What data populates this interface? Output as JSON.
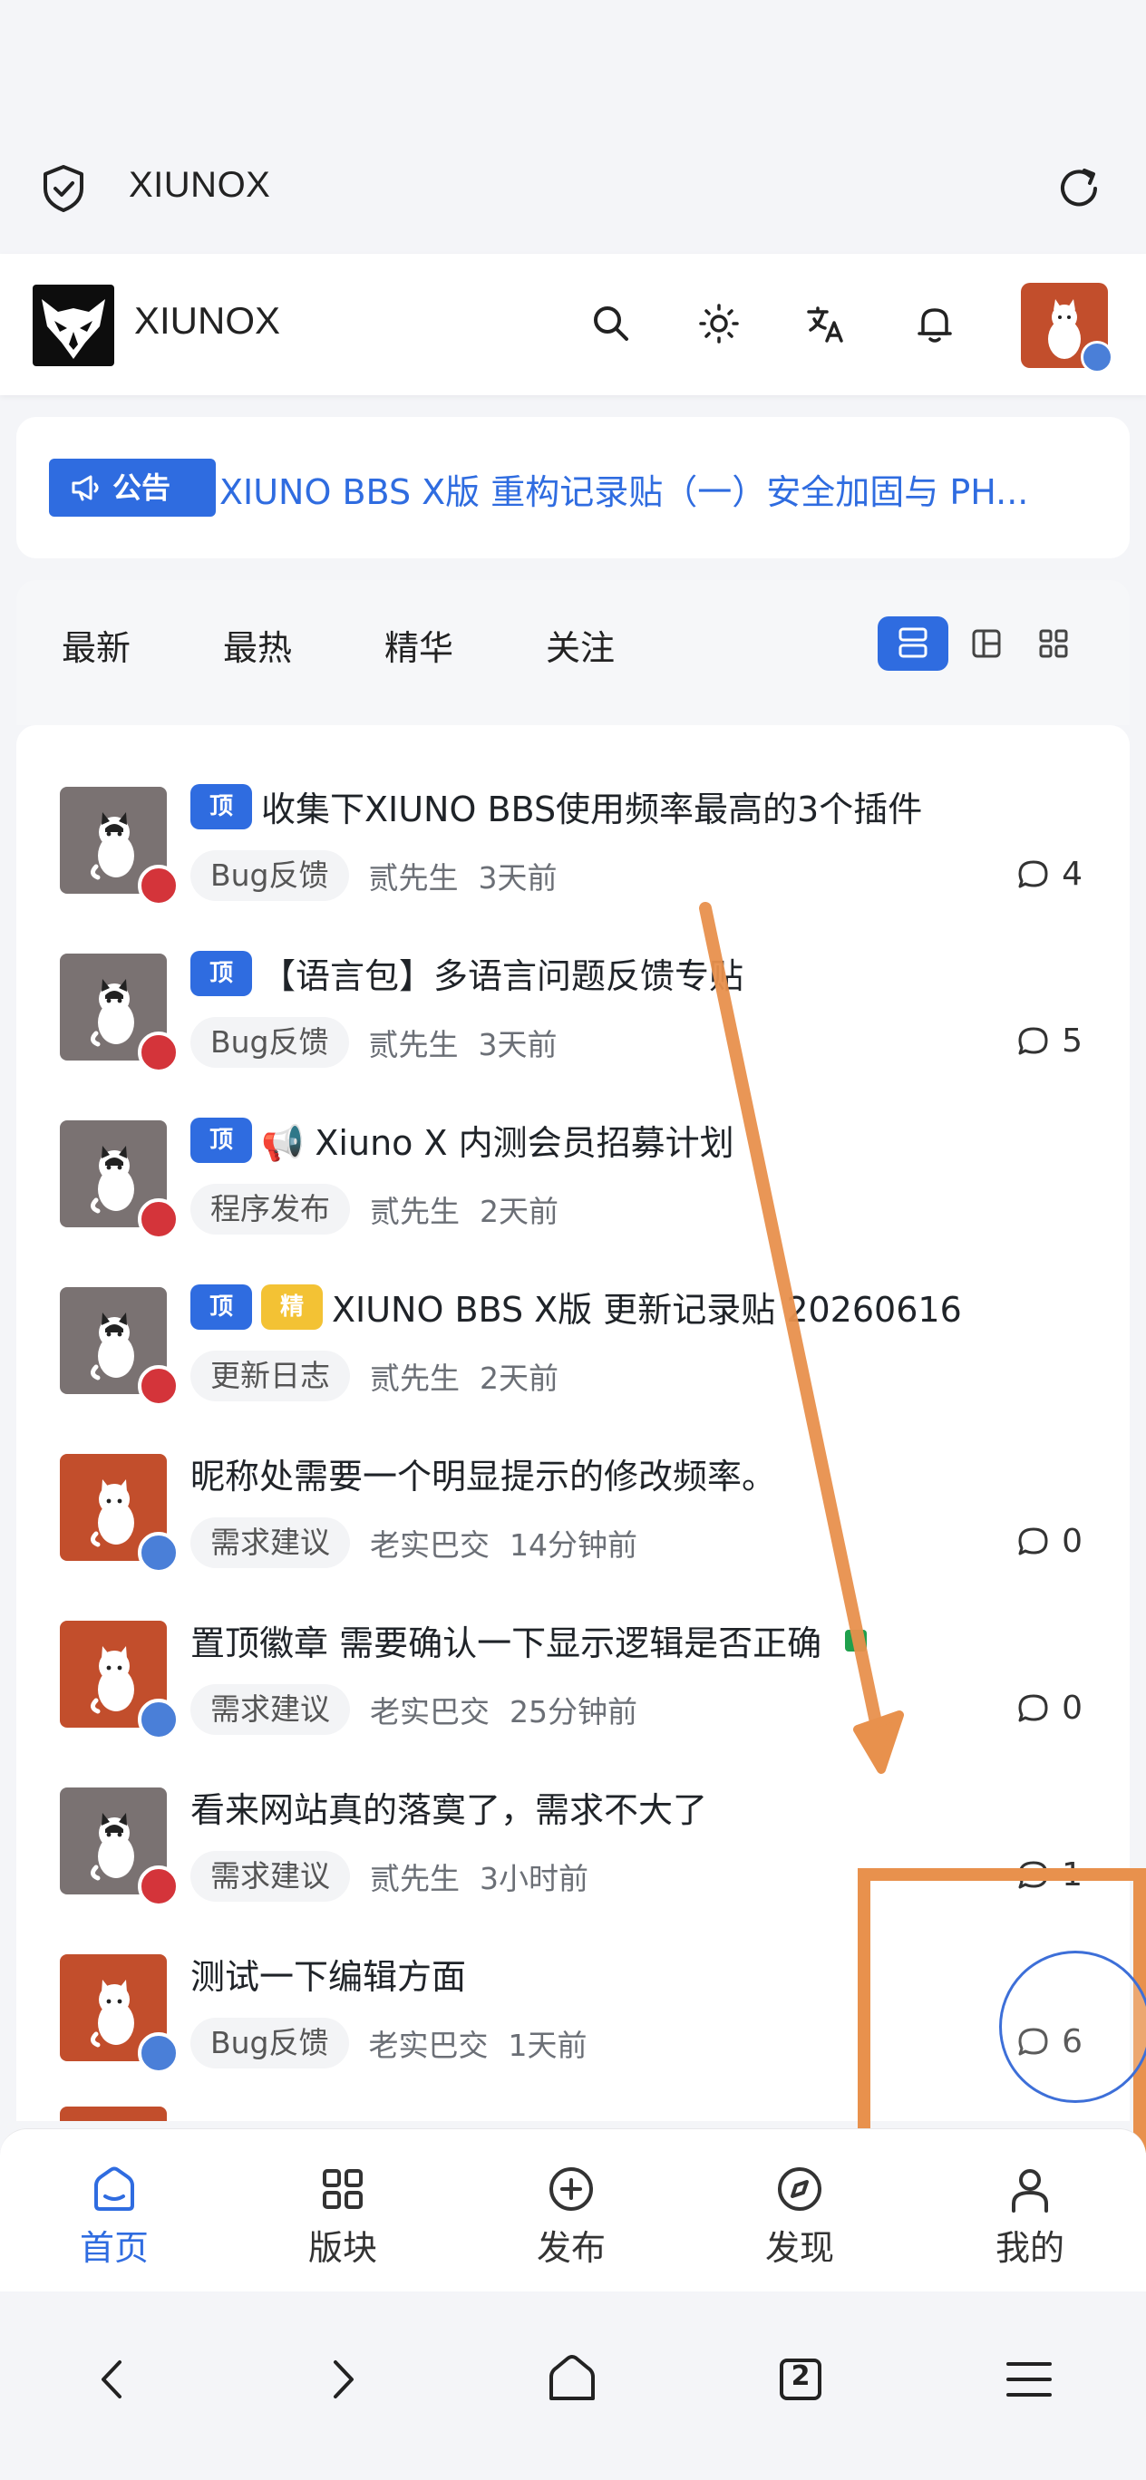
{
  "browser": {
    "url": "XIUNOX"
  },
  "header": {
    "site_name": "XIUNOX"
  },
  "announcement": {
    "badge": "公告",
    "text": "XIUNO BBS X版 重构记录贴（一）安全加固与 PH..."
  },
  "tabs": [
    "最新",
    "最热",
    "精华",
    "关注"
  ],
  "badges": {
    "pin": "顶",
    "featured": "精"
  },
  "topics": [
    {
      "title": "收集下XIUNO BBS使用频率最高的3个插件",
      "pinned": true,
      "featured": false,
      "category": "Bug反馈",
      "author": "贰先生",
      "time": "3天前",
      "replies": "4",
      "avatar": "gray"
    },
    {
      "title": "【语言包】多语言问题反馈专贴",
      "pinned": true,
      "featured": false,
      "category": "Bug反馈",
      "author": "贰先生",
      "time": "3天前",
      "replies": "5",
      "avatar": "gray"
    },
    {
      "title": "📢 Xiuno X 内测会员招募计划",
      "pinned": true,
      "featured": false,
      "category": "程序发布",
      "author": "贰先生",
      "time": "2天前",
      "replies": "",
      "avatar": "gray"
    },
    {
      "title": "XIUNO BBS X版 更新记录贴 20260616",
      "pinned": true,
      "featured": true,
      "category": "更新日志",
      "author": "贰先生",
      "time": "2天前",
      "replies": "",
      "avatar": "gray"
    },
    {
      "title": "昵称处需要一个明显提示的修改频率。",
      "pinned": false,
      "featured": false,
      "category": "需求建议",
      "author": "老实巴交",
      "time": "14分钟前",
      "replies": "0",
      "avatar": "orange"
    },
    {
      "title": "置顶徽章 需要确认一下显示逻辑是否正确",
      "pinned": false,
      "featured": false,
      "category": "需求建议",
      "author": "老实巴交",
      "time": "25分钟前",
      "replies": "0",
      "avatar": "orange",
      "has_image": true
    },
    {
      "title": "看来网站真的落寞了，需求不大了",
      "pinned": false,
      "featured": false,
      "category": "需求建议",
      "author": "贰先生",
      "time": "3小时前",
      "replies": "1",
      "avatar": "gray"
    },
    {
      "title": "测试一下编辑方面",
      "pinned": false,
      "featured": false,
      "category": "Bug反馈",
      "author": "老实巴交",
      "time": "1天前",
      "replies": "6",
      "avatar": "orange"
    }
  ],
  "bottom_nav": [
    {
      "label": "首页",
      "icon": "home-icon",
      "active": true
    },
    {
      "label": "版块",
      "icon": "grid-icon",
      "active": false
    },
    {
      "label": "发布",
      "icon": "plus-circle-icon",
      "active": false
    },
    {
      "label": "发现",
      "icon": "compass-icon",
      "active": false
    },
    {
      "label": "我的",
      "icon": "user-icon",
      "active": false
    }
  ],
  "system_nav": {
    "tab_count": "2"
  },
  "colors": {
    "accent": "#2f6ce0",
    "annotation": "#e8914d",
    "pin_badge": "#2f6ce0",
    "featured_badge": "#f3c234"
  }
}
